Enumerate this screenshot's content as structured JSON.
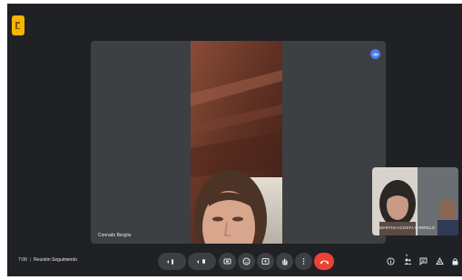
{
  "meeting": {
    "time": "7:00",
    "title": "Reunión Seguimiento"
  },
  "main_participant": {
    "name": "Conrado Bergós"
  },
  "thumbnail_participant": {
    "name": "MARTHA ACOSTA CARRILLO"
  },
  "participant_count": "6",
  "colors": {
    "background": "#202124",
    "tile": "#3c4043",
    "end_call": "#ea4335",
    "app_icon": "#f4b400",
    "speaker_indicator": "#4a7be8"
  },
  "controls": [
    "captions-icon",
    "microphone-icon",
    "camera-icon",
    "emoji-icon",
    "present-icon",
    "raise-hand-icon",
    "more-options-icon",
    "end-call-icon"
  ],
  "side_icons": [
    "info-icon",
    "people-icon",
    "chat-icon",
    "activities-icon",
    "lock-icon"
  ]
}
